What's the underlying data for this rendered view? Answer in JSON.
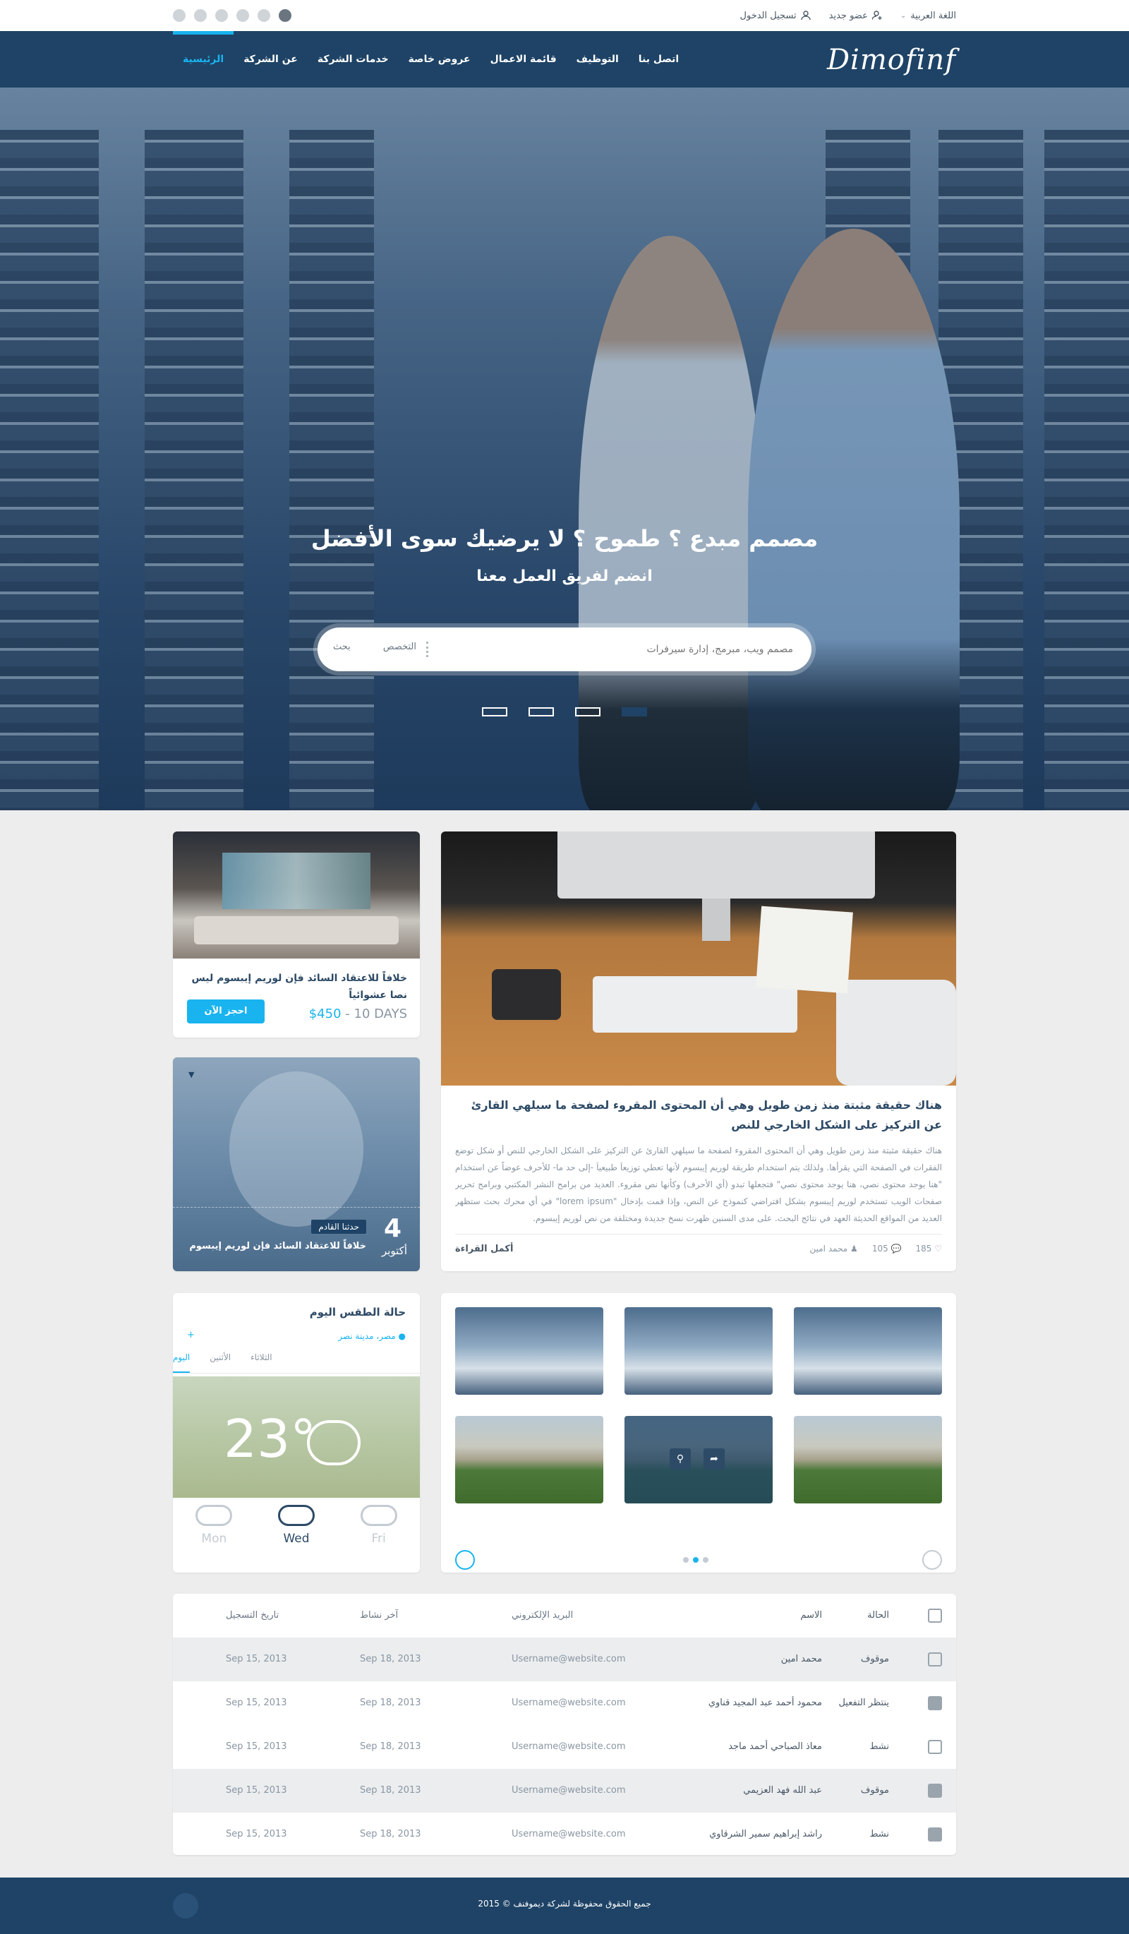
{
  "topbar": {
    "login": "تسجيل الدخول",
    "new_member": "عضو جديد",
    "language": "اللغة العربية",
    "social_icons": [
      "facebook-icon",
      "google-plus-icon",
      "dribbble-icon",
      "twitter-icon",
      "flickr-icon",
      "rss-icon"
    ]
  },
  "nav": {
    "logo": "Dimofinf",
    "items": [
      "الرئيسية",
      "عن الشركة",
      "خدمات الشركة",
      "عروض خاصة",
      "قائمة الاعمال",
      "التوظيف",
      "اتصل بنا"
    ]
  },
  "hero": {
    "title": "مصمم مبدع ؟ طموح ؟ لا يرضيك سوى الأفضل",
    "subtitle": "انضم لفريق العمل معنا",
    "search_placeholder": "مصمم ويب، مبرمج، إدارة سيرفرات",
    "specialty_label": "التخصص",
    "search_button": "بحث",
    "slides_count": 4,
    "active_slide": 4
  },
  "offer": {
    "title": "خلافاً للاعتقاد السائد فإن لوريم إيبسوم ليس نصا عشوائياً",
    "price": "$450",
    "duration": " - 10 DAYS",
    "button": "احجز الآن"
  },
  "event": {
    "day": "4",
    "month": "أكتوبر",
    "tag": "حدثنا القادم",
    "title": "خلافاً للاعتقاد السائد فإن لوريم إيبسوم"
  },
  "blog": {
    "title": "هناك حقيقة مثبتة منذ زمن طويل وهي أن المحتوى المقروء لصفحة ما سيلهي القارئ عن التركيز على الشكل الخارجي للنص",
    "body": "هناك حقيقة مثبتة منذ زمن طويل وهي أن المحتوى المقروء لصفحة ما سيلهي القارئ عن التركيز على الشكل الخارجي للنص أو شكل توضع الفقرات في الصفحة التي يقرأها. ولذلك يتم استخدام طريقة لوريم إيبسوم لأنها تعطي توزيعاَ طبيعياَ -إلى حد ما- للأحرف عوضاً عن استخدام \"هنا يوجد محتوى نصي، هنا يوجد محتوى نصي\" فتجعلها تبدو (أي الأحرف) وكأنها نص مقروء. العديد من برامح النشر المكتبي وبرامح تحرير صفحات الويب تستخدم لوريم إيبسوم بشكل افتراضي كنموذج عن النص، وإذا قمت بإدخال \"lorem ipsum\" في أي محرك بحث ستظهر العديد من المواقع الحديثة العهد في نتائج البحث. على مدى السنين ظهرت نسخ جديدة ومختلفة من نص لوريم إيبسوم.",
    "author": "محمد امين",
    "comments": "105",
    "likes": "185",
    "read_more": "أكمل القراءة"
  },
  "weather": {
    "title": "حالة الطقس اليوم",
    "location": "مصر، مدينة نصر",
    "add": "+",
    "tabs": [
      "اليوم",
      "الأثنين",
      "الثلاثاء"
    ],
    "temperature": "23°",
    "days": [
      "Mon",
      "Wed",
      "Fri"
    ],
    "active_day": "Wed"
  },
  "gallery": {
    "thumbs": 6,
    "active_page": 2,
    "pages": 3
  },
  "table": {
    "headers": {
      "state": "الحالة",
      "name": "الاسم",
      "email": "البريد الإلكتروني",
      "last_active": "آخر نشاط",
      "registered": "تاريخ التسجيل"
    },
    "rows": [
      {
        "state": "موقوف",
        "name": "محمد امين",
        "email": "Username@website.com",
        "last_active": "Sep 18, 2013",
        "registered": "Sep 15, 2013"
      },
      {
        "state": "ينتظر التفعيل",
        "name": "محمود أحمد عبد المجيد قناوي",
        "email": "Username@website.com",
        "last_active": "Sep 18, 2013",
        "registered": "Sep 15, 2013"
      },
      {
        "state": "نشط",
        "name": "معاذ الصباحي أحمد ماجد",
        "email": "Username@website.com",
        "last_active": "Sep 18, 2013",
        "registered": "Sep 15, 2013"
      },
      {
        "state": "موقوف",
        "name": "عبد الله فهد العزيمي",
        "email": "Username@website.com",
        "last_active": "Sep 18, 2013",
        "registered": "Sep 15, 2013"
      },
      {
        "state": "نشط",
        "name": "راشد إبراهيم سمير الشرقاوي",
        "email": "Username@website.com",
        "last_active": "Sep 18, 2013",
        "registered": "Sep 15, 2013"
      }
    ]
  },
  "footer": {
    "text": "جميع الحقوق محفوظة لشركة ديموفنف © 2015"
  },
  "colors": {
    "navy": "#1e4366",
    "accent": "#19b4ef",
    "background": "#ededed"
  }
}
